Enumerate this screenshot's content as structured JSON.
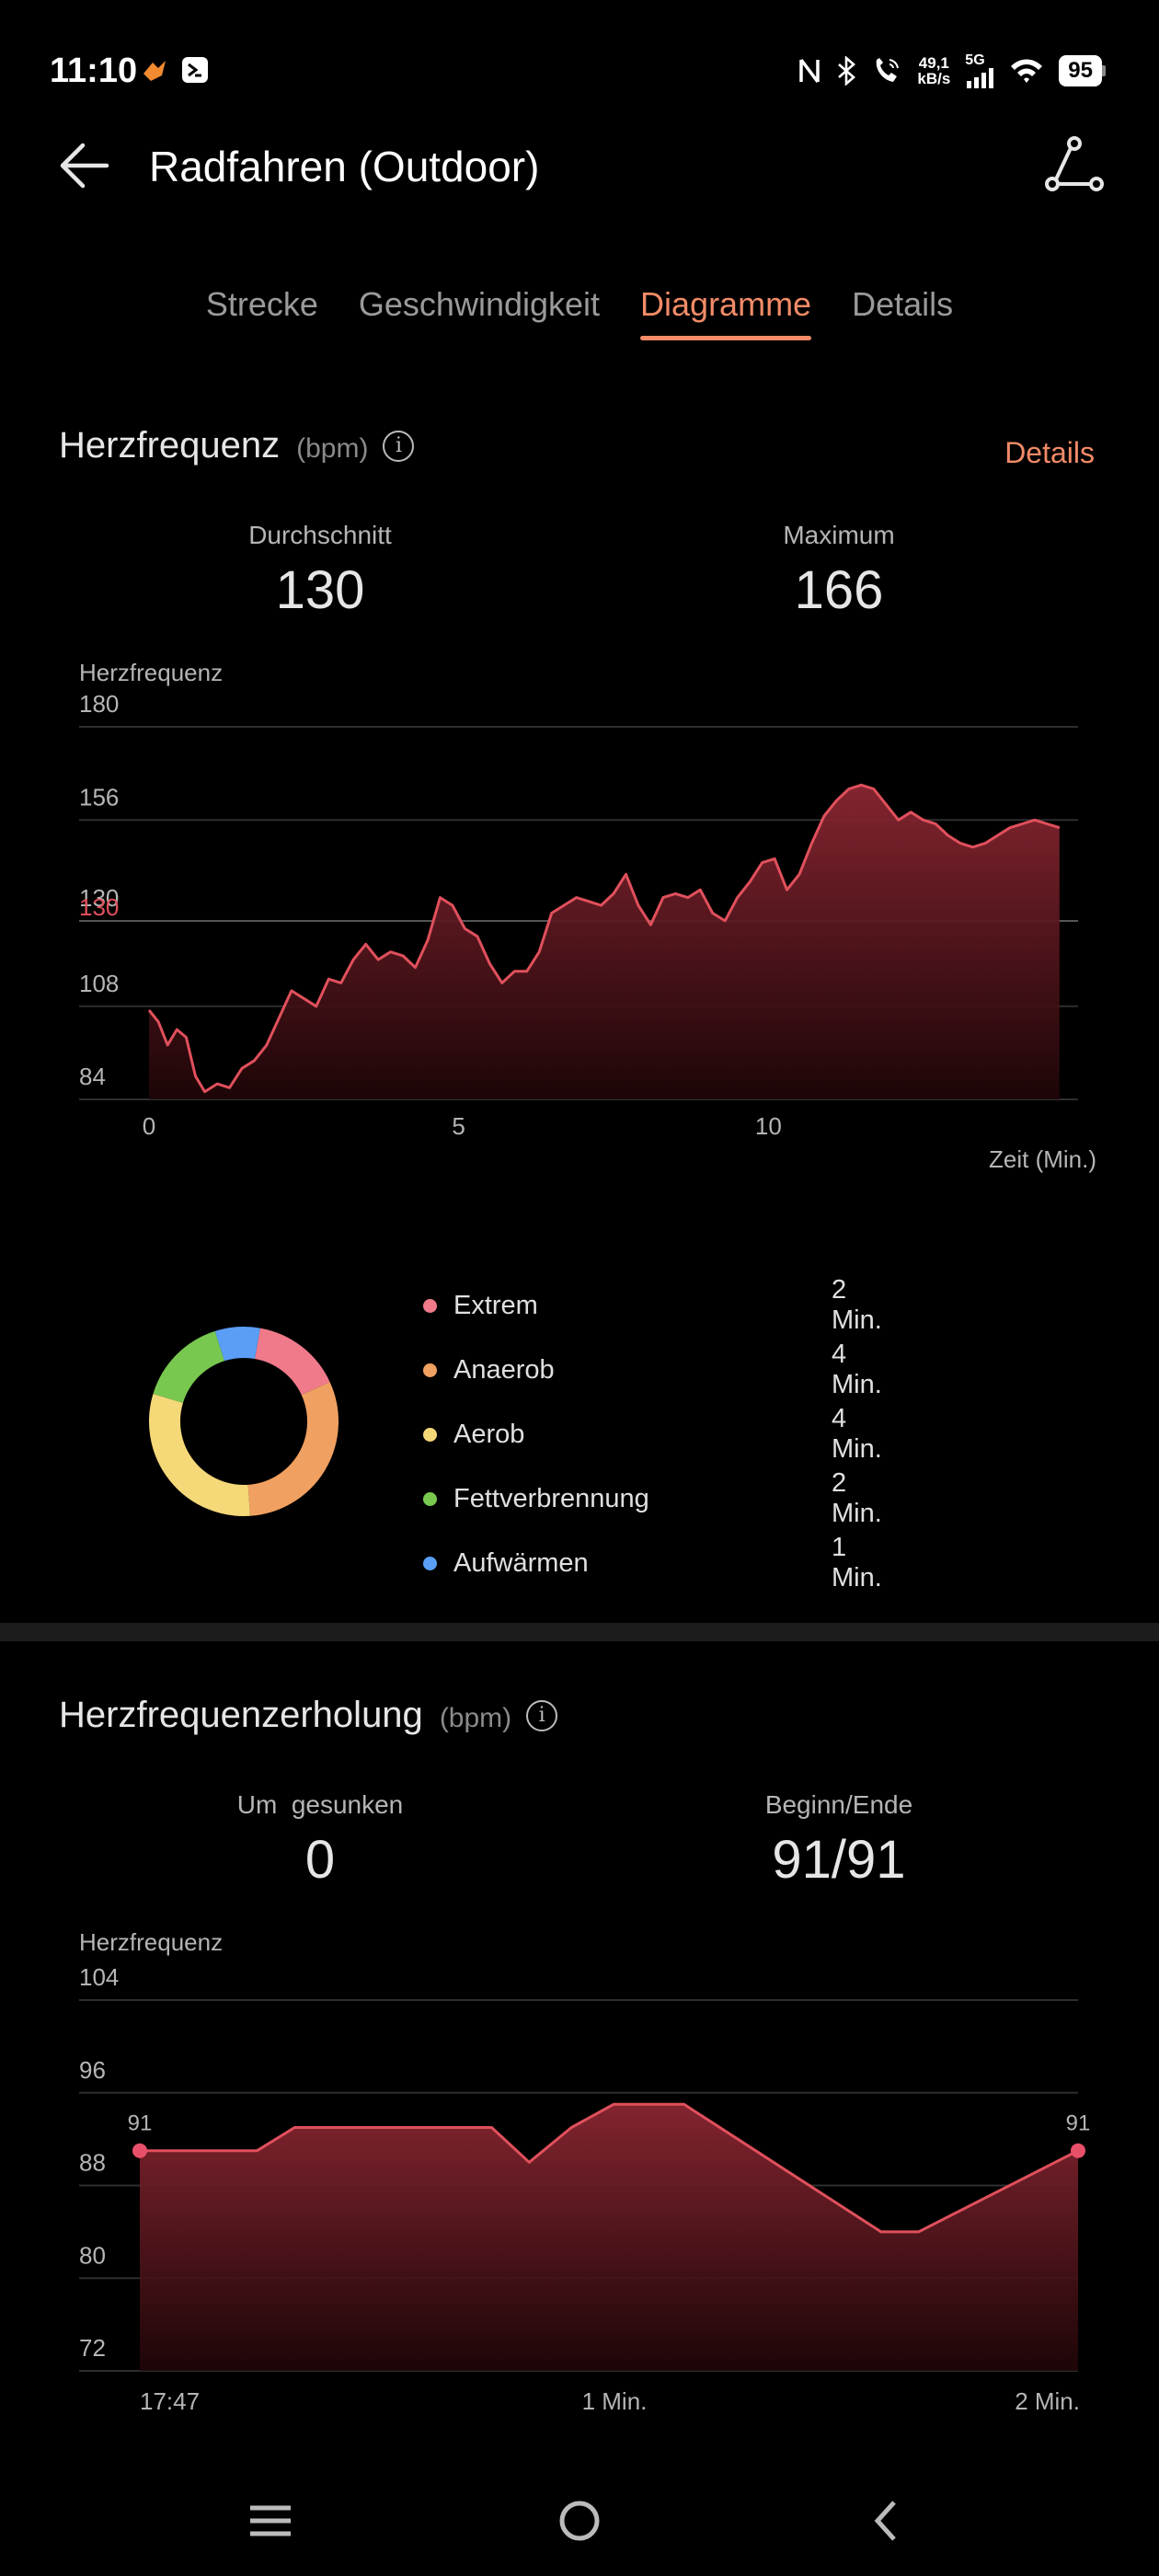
{
  "status_bar": {
    "time": "11:10",
    "net_speed_value": "49,1",
    "net_speed_unit": "kB/s",
    "network_type": "5G",
    "battery": "95"
  },
  "header": {
    "title": "Radfahren (Outdoor)"
  },
  "tabs": [
    {
      "label": "Strecke",
      "active": false
    },
    {
      "label": "Geschwindigkeit",
      "active": false
    },
    {
      "label": "Diagramme",
      "active": true
    },
    {
      "label": "Details",
      "active": false
    }
  ],
  "heart_rate": {
    "title": "Herzfrequenz",
    "unit": "(bpm)",
    "details_link": "Details",
    "avg_label": "Durchschnitt",
    "avg_value": "130",
    "max_label": "Maximum",
    "max_value": "166",
    "accent_color": "#f28b67",
    "line_color": "#e0505c"
  },
  "chart_data": [
    {
      "type": "area",
      "title": "",
      "ylabel": "Herzfrequenz",
      "xlabel": "Zeit (Min.)",
      "y_ticks": [
        "180",
        "156",
        "130",
        "108",
        "84"
      ],
      "x_ticks": [
        "0",
        "5",
        "10"
      ],
      "ylim": [
        84,
        180
      ],
      "xlim": [
        0,
        15
      ],
      "reference_line": 130,
      "x": [
        0,
        0.15,
        0.3,
        0.45,
        0.6,
        0.75,
        0.9,
        1.1,
        1.3,
        1.5,
        1.7,
        1.9,
        2.1,
        2.3,
        2.5,
        2.7,
        2.9,
        3.1,
        3.3,
        3.5,
        3.7,
        3.9,
        4.1,
        4.3,
        4.5,
        4.7,
        4.9,
        5.1,
        5.3,
        5.5,
        5.7,
        5.9,
        6.1,
        6.3,
        6.5,
        6.7,
        6.9,
        7.1,
        7.3,
        7.5,
        7.7,
        7.9,
        8.1,
        8.3,
        8.5,
        8.7,
        8.9,
        9.1,
        9.3,
        9.5,
        9.7,
        9.9,
        10.1,
        10.3,
        10.5,
        10.7,
        10.9,
        11.1,
        11.3,
        11.5,
        11.7,
        11.9,
        12.1,
        12.3,
        12.5,
        12.7,
        12.9,
        13.1,
        13.3,
        13.5,
        13.7,
        13.9,
        14.1,
        14.3,
        14.5,
        14.7
      ],
      "values": [
        107,
        104,
        98,
        102,
        100,
        90,
        86,
        88,
        87,
        92,
        94,
        98,
        105,
        112,
        110,
        108,
        115,
        114,
        120,
        124,
        120,
        122,
        121,
        118,
        125,
        136,
        134,
        128,
        126,
        119,
        114,
        117,
        117,
        122,
        132,
        134,
        136,
        135,
        134,
        137,
        142,
        134,
        129,
        136,
        137,
        136,
        138,
        132,
        130,
        136,
        140,
        145,
        146,
        138,
        142,
        150,
        157,
        161,
        164,
        165,
        164,
        160,
        156,
        158,
        156,
        155,
        152,
        150,
        149,
        150,
        152,
        154,
        155,
        156,
        155,
        154
      ],
      "series_color": "#e0505c"
    },
    {
      "type": "area",
      "title": "",
      "ylabel": "Herzfrequenz",
      "y_ticks": [
        "104",
        "96",
        "88",
        "80",
        "72"
      ],
      "x_ticks": [
        "17:47",
        "1 Min.",
        "2 Min."
      ],
      "ylim": [
        72,
        104
      ],
      "x": [
        0,
        0.25,
        0.33,
        0.75,
        0.83,
        0.92,
        1.01,
        1.16,
        1.58,
        1.66,
        2.0
      ],
      "values": [
        91,
        91,
        93,
        93,
        90,
        93,
        95,
        95,
        84,
        84,
        91
      ],
      "start_label": "91",
      "end_label": "91",
      "series_color": "#e0505c"
    }
  ],
  "zones": {
    "items": [
      {
        "name": "Extrem",
        "value": "2 Min.",
        "color": "#f07a8a",
        "minutes": 2
      },
      {
        "name": "Anaerob",
        "value": "4 Min.",
        "color": "#f0a060",
        "minutes": 4
      },
      {
        "name": "Aerob",
        "value": "4 Min.",
        "color": "#f5d878",
        "minutes": 4
      },
      {
        "name": "Fettverbrennung",
        "value": "2 Min.",
        "color": "#78c850",
        "minutes": 2
      },
      {
        "name": "Aufwärmen",
        "value": "1 Min.",
        "color": "#5a9ef5",
        "minutes": 1
      }
    ]
  },
  "recovery": {
    "title": "Herzfrequenzerholung",
    "unit": "(bpm)",
    "dropped_label": "Um  gesunken",
    "dropped_value": "0",
    "start_end_label": "Beginn/Ende",
    "start_end_value": "91/91"
  },
  "icons": {
    "back": "arrow-left-icon",
    "share": "route-share-icon",
    "info": "info-icon",
    "nav_menu": "menu-icon",
    "nav_home": "home-circle-icon",
    "nav_back": "chevron-left-icon"
  }
}
